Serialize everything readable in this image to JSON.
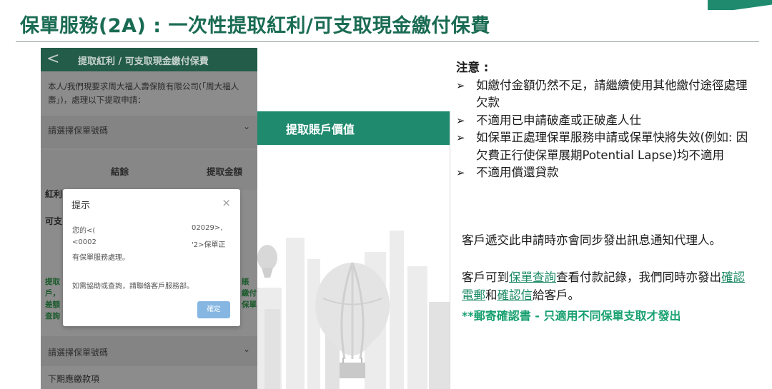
{
  "slide": {
    "title": "保單服務(2A) : 一次性提取紅利/可支取現金繳付保費"
  },
  "phone": {
    "header_back": "<",
    "header_title": "提取紅利 / 可支取現金繳付保費",
    "intro": "本人/我們現要求周大福人壽保險有限公司(「周大福人壽」)，處理以下提取申請：",
    "select_policy": "請選擇保單號碼",
    "chevron": "⌄",
    "col_balance": "結餘",
    "col_withdraw": "提取金額",
    "row_bonus": "紅利",
    "row_cash": "可支",
    "green_left": [
      "提取",
      "戶，",
      "差額",
      "查詢"
    ],
    "green_right": [
      "賬",
      "繳付",
      "保單"
    ],
    "select_policy_2": "請選擇保單號碼",
    "next_due": "下期應繳款項"
  },
  "dialog": {
    "title": "提示",
    "close": "×",
    "line1_left": "您的<(",
    "line1_right": "02029>,",
    "line2_left": "<0002",
    "line2_right": "'2>保單正",
    "line3": "有保單服務處理。",
    "line4": "如需協助或查詢，請聯絡客戶服務部。",
    "confirm": "確定"
  },
  "panel2": {
    "header": "提取賬戶價值"
  },
  "notes": {
    "heading": "注意 :",
    "items": [
      "如繳付金額仍然不足，請繼續使用其他繳付途徑處理欠款",
      "不適用已申請破產或正破產人仕",
      "如保單正處理保單服務申請或保單快將失效(例如: 因欠費正行使保單展期Potential Lapse)均不適用",
      "不適用償還貸款"
    ]
  },
  "notify": "客戶遞交此申請時亦會同步發出訊息通知代理人。",
  "record": {
    "p1": "客戶可到",
    "link1": "保單查詢",
    "p2": "查看付款記錄，我們同時亦發出",
    "link2": "確認電郵",
    "p3": "和",
    "link3": "確認信",
    "p4": "給客戶。"
  },
  "mail_note": "**郵寄確認書 - 只適用不同保單支取才發出",
  "colors": {
    "title_green": "#1a6b53",
    "panel_green": "#1f8a6e",
    "link_green": "#1c8a66",
    "mail_green": "#16a070",
    "dialog_button": "#86b7e2"
  }
}
